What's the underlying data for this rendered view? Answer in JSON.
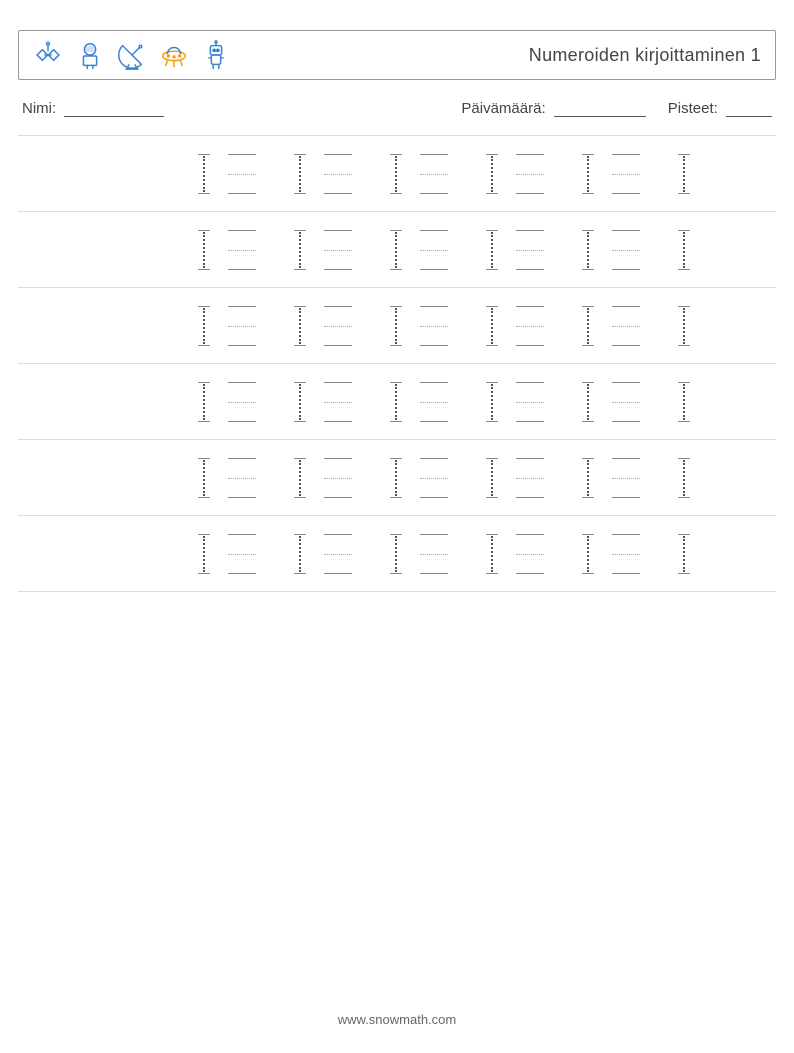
{
  "header": {
    "title": "Numeroiden kirjoittaminen 1",
    "icons": [
      "satellite-icon",
      "astronaut-icon",
      "radar-dish-icon",
      "ufo-icon",
      "robot-icon"
    ]
  },
  "meta": {
    "name_label": "Nimi:",
    "date_label": "Päivämäärä:",
    "score_label": "Pisteet:"
  },
  "practice": {
    "rows": 6,
    "trace_cells_per_row": 5,
    "blank_cells_per_row": 5,
    "digit": "1"
  },
  "footer": {
    "url": "www.snowmath.com"
  }
}
